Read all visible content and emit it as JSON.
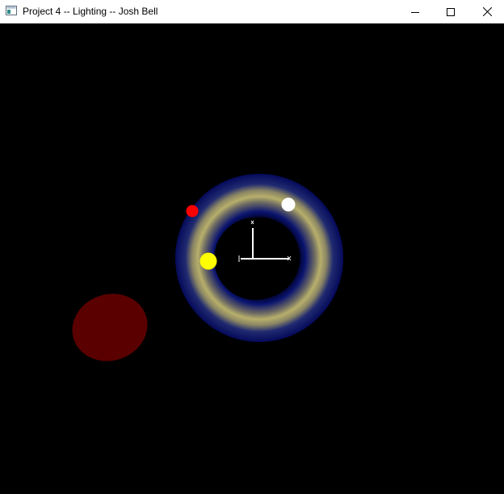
{
  "window": {
    "title": "Project 4 -- Lighting -- Josh Bell",
    "icon": "app-window-icon",
    "controls": {
      "minimize_icon": "minimize-icon",
      "maximize_icon": "maximize-icon",
      "close_icon": "close-icon"
    }
  },
  "scene": {
    "background_color": "#000000",
    "torus": {
      "outer_color": "#050a5a",
      "highlight_color": "#b4ad6a"
    },
    "lights": [
      {
        "name": "red-light",
        "color": "#ff0000"
      },
      {
        "name": "white-light",
        "color": "#ffffff"
      },
      {
        "name": "yellow-light",
        "color": "#ffff00"
      }
    ],
    "ellipsoid_color": "#5a0000",
    "axes_color": "#ffffff"
  }
}
